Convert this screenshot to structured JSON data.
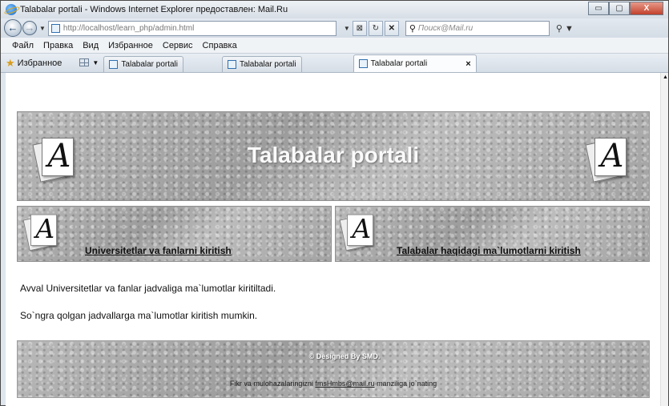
{
  "window": {
    "title": "Talabalar portali - Windows Internet Explorer предоставлен: Mail.Ru",
    "buttons": {
      "minimize": "▭",
      "maximize": "▢",
      "close": "X"
    }
  },
  "addressbar": {
    "url": "http://localhost/learn_php/admin.html",
    "search_placeholder": "Поиск@Mail.ru",
    "tools": {
      "compat": "⊠",
      "refresh": "↻",
      "stop": "✕"
    }
  },
  "menubar": {
    "items": [
      "Файл",
      "Правка",
      "Вид",
      "Избранное",
      "Сервис",
      "Справка"
    ]
  },
  "favbar": {
    "favorites_label": "Избранное",
    "tabs": [
      {
        "label": "Talabalar portali",
        "active": false
      },
      {
        "label": "Talabalar portali",
        "active": false
      },
      {
        "label": "Talabalar portali",
        "active": true
      }
    ],
    "tab_close": "×"
  },
  "page": {
    "site_title": "Talabalar portali",
    "logo_letter": "A",
    "nav": {
      "left_link": "Universitetlar va fanlarni kiritish",
      "right_link": "Talabalar haqidagi ma`lumotlarni kiritish"
    },
    "paragraphs": [
      "Avval Universitetlar va fanlar jadvaliga ma`lumotlar kiritiltadi.",
      "So`ngra qolgan jadvallarga ma`lumotlar kiritish mumkin."
    ],
    "footer": {
      "designed": "© Designed By SMD.",
      "contact_prefix": "Fikr va mulohazalaringizni ",
      "contact_email": "fmsHmbs@mail.ru",
      "contact_suffix": " manziliga jo`nating"
    }
  }
}
